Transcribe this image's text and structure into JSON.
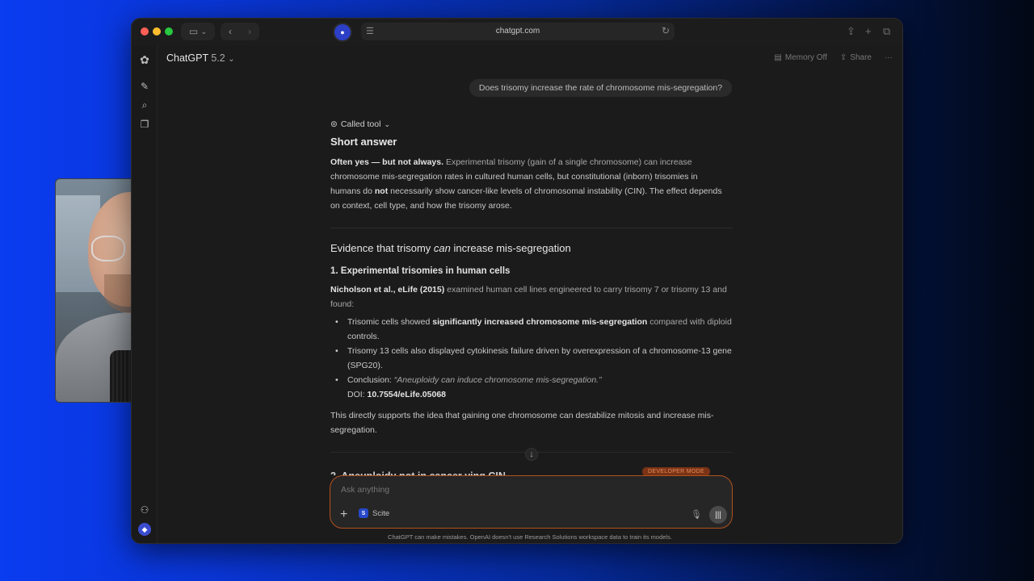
{
  "browser": {
    "url": "chatgpt.com"
  },
  "header": {
    "app_name": "ChatGPT",
    "model_version": "5.2",
    "memory_label": "Memory Off",
    "share_label": "Share",
    "more_label": "···"
  },
  "chat": {
    "user_message": "Does trisomy increase the rate of chromosome mis-segregation?",
    "called_tool_label": "Called tool",
    "short_answer_heading": "Short answer",
    "short_answer": {
      "p1_bold": "Often yes — but not always.",
      "p1_a": " Experimental trisomy (gain of a single chromosome) can increase ",
      "p1_b": "chromosome mis-segregation rates in cultured human cells, but constitutional (inborn) trisomies in ",
      "p1_c": "humans do ",
      "p1_not": "not",
      "p1_d": " necessarily show cancer-like levels of chromosomal instability (CIN). The effect depends ",
      "p1_e": "on context, cell type, and how the trisomy arose."
    },
    "evidence_heading_pre": "Evidence that trisomy ",
    "evidence_heading_em": "can",
    "evidence_heading_post": " increase mis-segregation",
    "sub_heading_1": "1. Experimental trisomies in human cells",
    "study_citation": "Nicholson et al., eLife (2015)",
    "study_intro_a": " examined human cell lines engineered to carry trisomy 7 or trisomy 13 and ",
    "study_intro_b": "found:",
    "bullet1_a": "Trisomic cells showed ",
    "bullet1_bold": "significantly increased chromosome mis-segregation",
    "bullet1_b": " compared with diploid ",
    "bullet1_c": "controls.",
    "bullet2_a": "Trisomy 13 cells also displayed cytokinesis failure driven by overexpression of a chromosome-13 gene ",
    "bullet2_b": "(SPG20).",
    "bullet3_label": "Conclusion: ",
    "bullet3_quote": "“Aneuploidy can induce chromosome mis-segregation.”",
    "doi_label": "DOI: ",
    "doi_value": "10.7554/eLife.05068",
    "conclusion_a": "This directly supports the idea that gaining one chromosome can destabilize mitosis and increase mis-",
    "conclusion_b": "segregation.",
    "next_heading_partial": "2. Aneuploidy not in cancer ving CIN",
    "developer_mode_badge": "DEVELOPER MODE"
  },
  "composer": {
    "placeholder": "Ask anything",
    "tool_chip_label": "Scite",
    "tool_chip_logo": "S",
    "disclaimer": "ChatGPT can make mistakes. OpenAI doesn't use Research Solutions workspace data to train its models."
  },
  "icons": {
    "sidebar": [
      "chatgpt-logo-icon",
      "new-chat-icon",
      "search-icon",
      "library-icon",
      "group-icon",
      "profile-icon"
    ],
    "composer": [
      "plus-icon",
      "mic-icon",
      "voice-mode-icon"
    ]
  },
  "colors": {
    "background_gradient_start": "#0a3cf0",
    "window_bg": "#1b1b1b",
    "composer_border": "#b3501f",
    "developer_badge": "#7a3315",
    "scite_blue": "#2748c9"
  }
}
